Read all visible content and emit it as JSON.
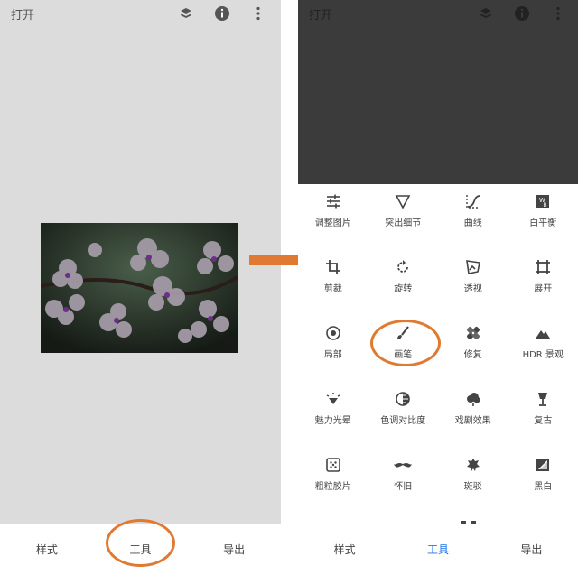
{
  "left": {
    "title": "打开",
    "icons": [
      "layers-swap-icon",
      "info-icon",
      "more-vert-icon"
    ],
    "bottom_nav": [
      "样式",
      "工具",
      "导出"
    ]
  },
  "right": {
    "title": "打开",
    "icons": [
      "layers-swap-icon",
      "info-icon",
      "more-vert-icon"
    ],
    "tools": [
      {
        "label": "调整图片",
        "icon": "tune-icon"
      },
      {
        "label": "突出细节",
        "icon": "triangle-icon"
      },
      {
        "label": "曲线",
        "icon": "curves-icon"
      },
      {
        "label": "白平衡",
        "icon": "white-balance-icon"
      },
      {
        "label": "剪裁",
        "icon": "crop-icon"
      },
      {
        "label": "旋转",
        "icon": "rotate-icon"
      },
      {
        "label": "透视",
        "icon": "perspective-icon"
      },
      {
        "label": "展开",
        "icon": "expand-icon"
      },
      {
        "label": "局部",
        "icon": "target-icon"
      },
      {
        "label": "画笔",
        "icon": "brush-icon"
      },
      {
        "label": "修复",
        "icon": "healing-icon"
      },
      {
        "label": "HDR 景观",
        "icon": "mountain-icon"
      },
      {
        "label": "魅力光晕",
        "icon": "glamour-glow-icon"
      },
      {
        "label": "色调对比度",
        "icon": "tonal-contrast-icon"
      },
      {
        "label": "戏剧效果",
        "icon": "drama-cloud-icon"
      },
      {
        "label": "复古",
        "icon": "lamp-icon"
      },
      {
        "label": "粗粒胶片",
        "icon": "grainy-film-icon"
      },
      {
        "label": "怀旧",
        "icon": "mustache-icon"
      },
      {
        "label": "斑驳",
        "icon": "grunge-icon"
      },
      {
        "label": "黑白",
        "icon": "black-white-icon"
      }
    ],
    "bottom_nav": [
      "样式",
      "工具",
      "导出"
    ],
    "active_nav_color": "#1a73e8"
  },
  "annotation_color": "#e07a32"
}
